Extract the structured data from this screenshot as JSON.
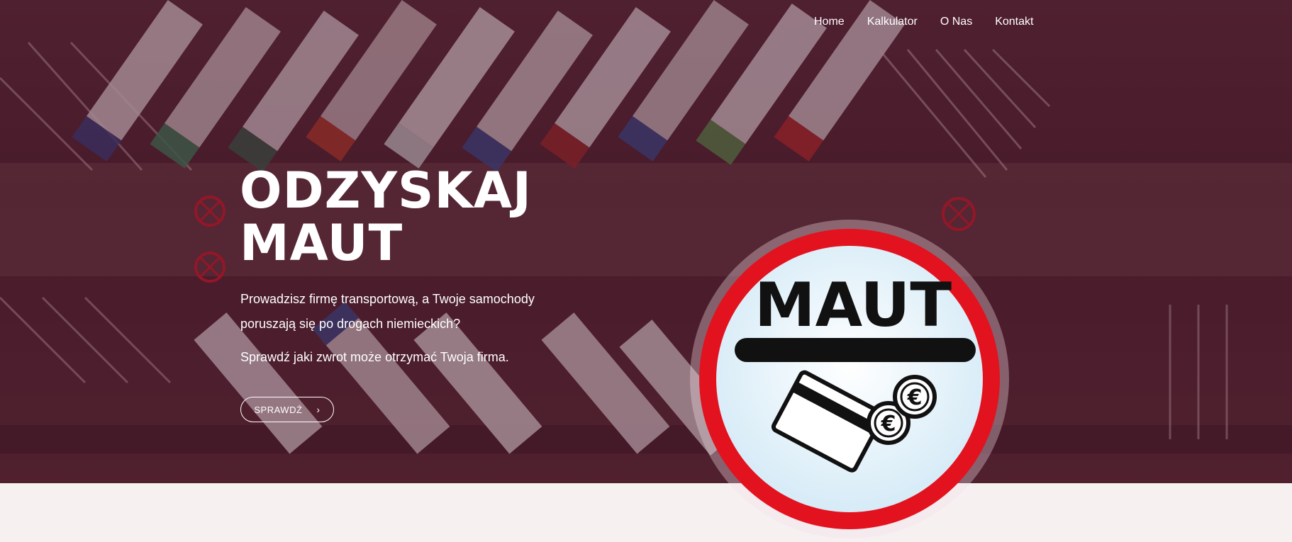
{
  "nav": {
    "items": [
      {
        "label": "Home"
      },
      {
        "label": "Kalkulator"
      },
      {
        "label": "O Nas"
      },
      {
        "label": "Kontakt"
      }
    ]
  },
  "hero": {
    "title_line1": "ODZYSKAJ",
    "title_line2": "MAUT",
    "lead": "Prowadzisz firmę transportową, a Twoje samochody poruszają się po drogach niemieckich?",
    "lead2": "Sprawdź jaki zwrot może otrzymać Twoja firma.",
    "cta_label": "SPRAWDŹ"
  },
  "sign": {
    "text": "MAUT",
    "currency_symbol": "€"
  },
  "colors": {
    "overlay": "#4f2230",
    "sign_ring": "#e3121f",
    "sign_face": "#eaf4fb",
    "page_bg": "#f7f0f1"
  }
}
